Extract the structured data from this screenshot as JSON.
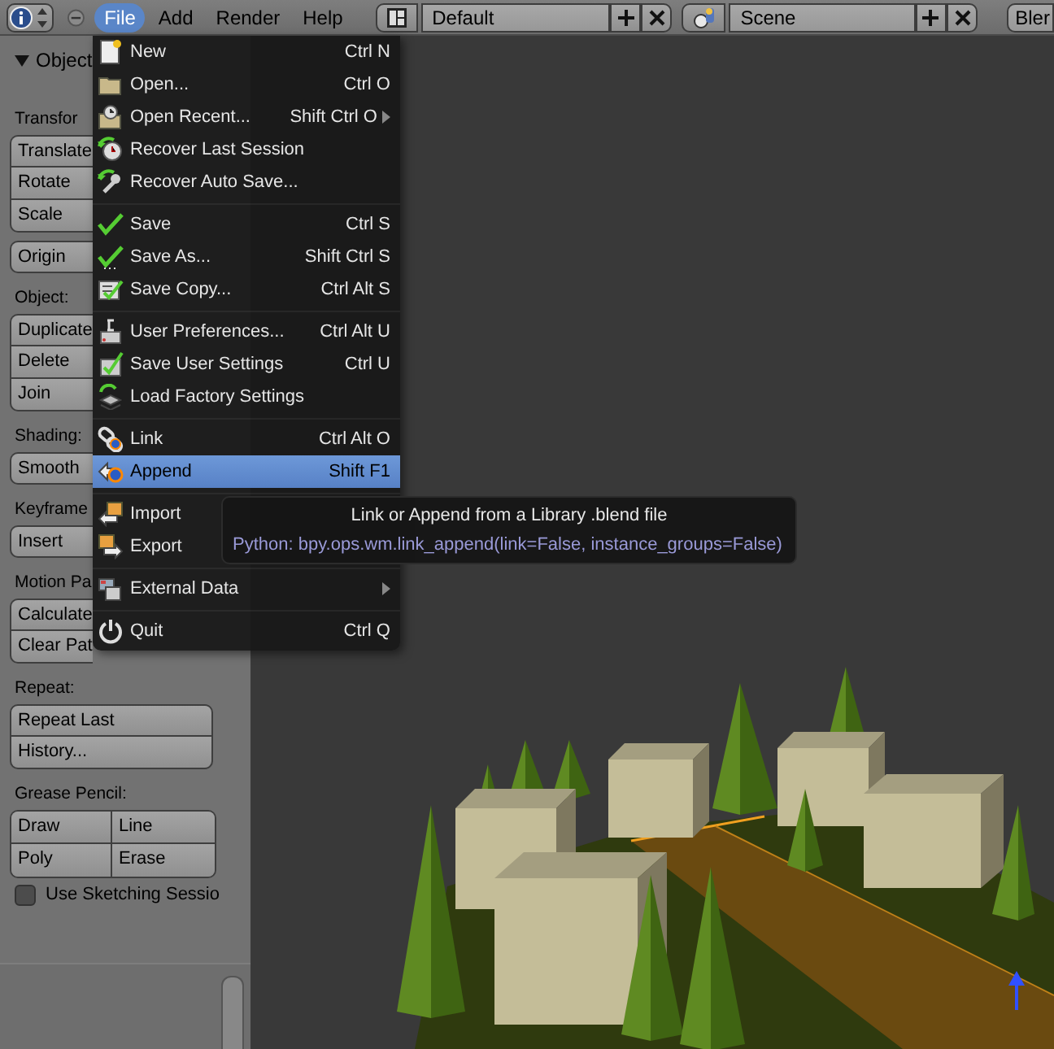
{
  "header": {
    "menus": [
      {
        "label": "File",
        "selected": true
      },
      {
        "label": "Add",
        "selected": false
      },
      {
        "label": "Render",
        "selected": false
      },
      {
        "label": "Help",
        "selected": false
      }
    ],
    "screen_layout": "Default",
    "scene": "Scene",
    "render_engine": "Bler"
  },
  "toolbar": {
    "title": "Object",
    "expanded": true,
    "rows": [
      {
        "kind": "label",
        "text": "Transfor"
      },
      {
        "kind": "buttons",
        "labels": [
          "Translate",
          "Rotate",
          "Scale"
        ]
      },
      {
        "kind": "buttons",
        "labels": [
          "Origin"
        ]
      },
      {
        "kind": "label",
        "text": "Object:"
      },
      {
        "kind": "buttons",
        "labels": [
          "Duplicate",
          "Delete",
          "Join"
        ]
      },
      {
        "kind": "label",
        "text": "Shading:"
      },
      {
        "kind": "buttons",
        "labels": [
          "Smooth"
        ]
      },
      {
        "kind": "label",
        "text": "Keyframe"
      },
      {
        "kind": "buttons",
        "labels": [
          "Insert"
        ]
      },
      {
        "kind": "label",
        "text": "Motion Pa"
      },
      {
        "kind": "buttons",
        "labels": [
          "Calculate",
          "Clear Pat"
        ]
      },
      {
        "kind": "label",
        "text": "Repeat:"
      },
      {
        "kind": "buttons",
        "labels": [
          "Repeat Last",
          "History..."
        ]
      },
      {
        "kind": "label",
        "text": "Grease Pencil:"
      },
      {
        "kind": "grid",
        "rows": [
          [
            "Draw",
            "Line"
          ],
          [
            "Poly",
            "Erase"
          ]
        ]
      },
      {
        "kind": "checkbox",
        "label": "Use Sketching Sessio",
        "checked": false
      }
    ]
  },
  "file_menu": {
    "items": [
      {
        "kind": "item",
        "label": "New",
        "shortcut": "Ctrl N",
        "submenu": false,
        "selected": false
      },
      {
        "kind": "item",
        "label": "Open...",
        "shortcut": "Ctrl O",
        "submenu": false,
        "selected": false
      },
      {
        "kind": "item",
        "label": "Open Recent...",
        "shortcut": "Shift Ctrl O",
        "submenu": true,
        "selected": false
      },
      {
        "kind": "item",
        "label": "Recover Last Session",
        "submenu": false,
        "selected": false
      },
      {
        "kind": "item",
        "label": "Recover Auto Save...",
        "submenu": false,
        "selected": false
      },
      {
        "kind": "separator"
      },
      {
        "kind": "item",
        "label": "Save",
        "shortcut": "Ctrl S",
        "submenu": false,
        "selected": false
      },
      {
        "kind": "item",
        "label": "Save As...",
        "shortcut": "Shift Ctrl S",
        "submenu": false,
        "selected": false
      },
      {
        "kind": "item",
        "label": "Save Copy...",
        "shortcut": "Ctrl Alt S",
        "submenu": false,
        "selected": false
      },
      {
        "kind": "separator"
      },
      {
        "kind": "item",
        "label": "User Preferences...",
        "shortcut": "Ctrl Alt U",
        "submenu": false,
        "selected": false
      },
      {
        "kind": "item",
        "label": "Save User Settings",
        "shortcut": "Ctrl U",
        "submenu": false,
        "selected": false
      },
      {
        "kind": "item",
        "label": "Load Factory Settings",
        "submenu": false,
        "selected": false
      },
      {
        "kind": "separator"
      },
      {
        "kind": "item",
        "label": "Link",
        "shortcut": "Ctrl Alt O",
        "submenu": false,
        "selected": false
      },
      {
        "kind": "item",
        "label": "Append",
        "shortcut": "Shift F1",
        "submenu": false,
        "selected": true
      },
      {
        "kind": "separator"
      },
      {
        "kind": "item",
        "label": "Import",
        "submenu": false,
        "selected": false
      },
      {
        "kind": "item",
        "label": "Export",
        "submenu": false,
        "selected": false
      },
      {
        "kind": "separator"
      },
      {
        "kind": "item",
        "label": "External Data",
        "submenu": true,
        "selected": false
      },
      {
        "kind": "separator"
      },
      {
        "kind": "item",
        "label": "Quit",
        "shortcut": "Ctrl Q",
        "submenu": false,
        "selected": false
      }
    ]
  },
  "tooltip": {
    "title": "Link or Append from a Library .blend file",
    "python": "Python: bpy.ops.wm.link_append(link=False, instance_groups=False)"
  }
}
